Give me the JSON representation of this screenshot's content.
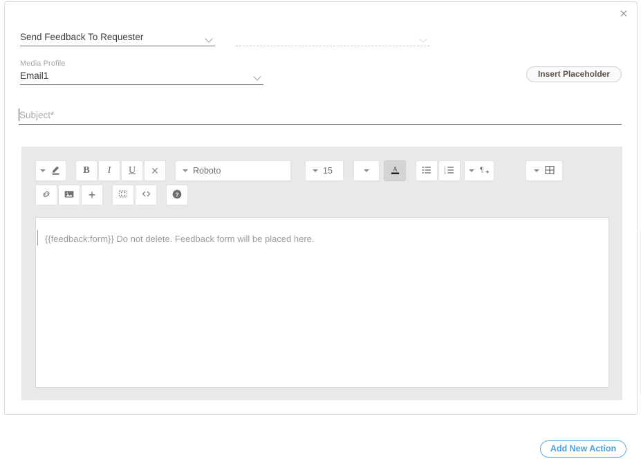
{
  "dialog": {
    "close_label": "✕",
    "close_icon": "close-icon"
  },
  "action_select": {
    "value": "Send Feedback To Requester",
    "caret_icon": "chevron-down-icon"
  },
  "secondary_select": {
    "value": "",
    "placeholder": "",
    "caret_icon": "chevron-down-icon"
  },
  "media_profile": {
    "label": "Media Profile",
    "value": "Email1",
    "caret_icon": "chevron-down-icon"
  },
  "insert_placeholder": {
    "label": "Insert Placeholder"
  },
  "subject": {
    "placeholder": "Subject*",
    "value": ""
  },
  "editor": {
    "toolbar": {
      "row1": [
        {
          "name": "text-style-pen-button",
          "icon": "pencil-icon",
          "label": "",
          "has_caret": true
        },
        {
          "name": "bold-button",
          "icon": "bold-icon",
          "label": "B",
          "has_caret": false
        },
        {
          "name": "italic-button",
          "icon": "italic-icon",
          "label": "I",
          "has_caret": false
        },
        {
          "name": "underline-button",
          "icon": "underline-icon",
          "label": "U",
          "has_caret": false
        },
        {
          "name": "clear-format-button",
          "icon": "x-icon",
          "label": "✕",
          "has_caret": false
        },
        {
          "name": "font-family-select",
          "icon": "font-icon",
          "label": "Roboto",
          "has_caret": true
        },
        {
          "name": "font-size-select",
          "icon": "font-size-icon",
          "label": "15",
          "has_caret": true
        },
        {
          "name": "font-size-more-button",
          "icon": "chevron-down-icon",
          "label": "",
          "has_caret": true
        },
        {
          "name": "text-color-button",
          "icon": "text-color-a-icon",
          "label": "A",
          "has_caret": false,
          "active": true
        },
        {
          "name": "bullet-list-button",
          "icon": "bullet-list-icon",
          "label": "",
          "has_caret": false
        },
        {
          "name": "numbered-list-button",
          "icon": "numbered-list-icon",
          "label": "",
          "has_caret": false
        },
        {
          "name": "paragraph-direction-button",
          "icon": "pilcrow-icon",
          "label": "",
          "has_caret": true
        },
        {
          "name": "insert-table-button",
          "icon": "table-icon",
          "label": "",
          "has_caret": true
        }
      ],
      "row2": [
        {
          "name": "insert-link-button",
          "icon": "link-icon"
        },
        {
          "name": "insert-image-button",
          "icon": "image-icon"
        },
        {
          "name": "insert-more-button",
          "icon": "plus-icon"
        },
        {
          "name": "fullscreen-button",
          "icon": "fullscreen-icon"
        },
        {
          "name": "source-code-button",
          "icon": "code-icon"
        },
        {
          "name": "help-button",
          "icon": "help-circle-icon"
        }
      ]
    },
    "body_text": "{{feedback:form}} Do not delete. Feedback form will be placed here."
  },
  "footer": {
    "add_action_label": "Add New Action"
  },
  "colors": {
    "accent_blue": "#4ba3e3",
    "toolbar_bg": "#e9e9e9",
    "active_btn_bg": "#d4d4d4",
    "placeholder_btn_text": "#5a5147"
  }
}
